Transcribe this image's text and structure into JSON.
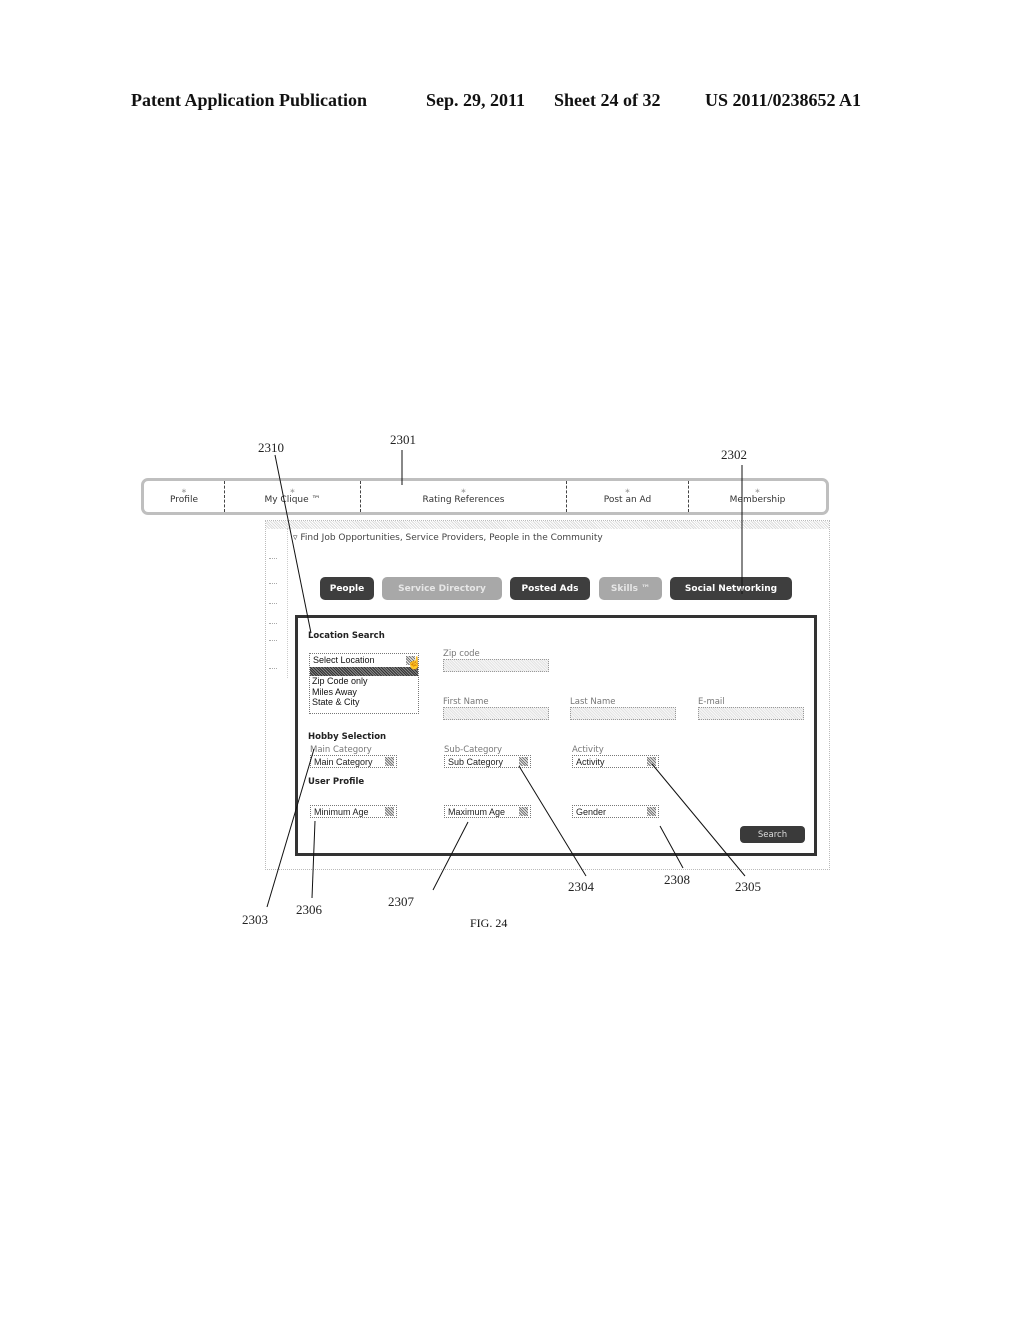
{
  "header": {
    "publication": "Patent Application Publication",
    "date": "Sep. 29, 2011",
    "sheet": "Sheet 24 of 32",
    "number": "US 2011/0238652 A1"
  },
  "reference_numerals": {
    "r2301": "2301",
    "r2302": "2302",
    "r2303": "2303",
    "r2304": "2304",
    "r2305": "2305",
    "r2306": "2306",
    "r2307": "2307",
    "r2308": "2308",
    "r2310": "2310"
  },
  "nav": {
    "items": [
      {
        "label": "Profile"
      },
      {
        "label": "My Clique ™"
      },
      {
        "label": "Rating References"
      },
      {
        "label": "Post an Ad"
      },
      {
        "label": "Membership"
      }
    ],
    "dot": "∗"
  },
  "panel": {
    "title": "▿ Find Job Opportunities, Service Providers, People in the Community",
    "tabs": [
      {
        "label": "People",
        "style": "dark"
      },
      {
        "label": "Service Directory",
        "style": "light"
      },
      {
        "label": "Posted Ads",
        "style": "dark"
      },
      {
        "label": "Skills ™",
        "style": "light"
      },
      {
        "label": "Social Networking",
        "style": "dark"
      }
    ]
  },
  "form": {
    "location_heading": "Location Search",
    "location_select": {
      "value": "Select Location",
      "options": [
        "Zip Code only",
        "Miles Away",
        "State & City"
      ]
    },
    "zip_label": "Zip code",
    "first_name_label": "First Name",
    "last_name_label": "Last Name",
    "email_label": "E-mail",
    "hobby_heading": "Hobby Selection",
    "main_category_label": "Main Category",
    "main_category_value": "Main Category",
    "sub_category_label": "Sub-Category",
    "sub_category_value": "Sub Category",
    "activity_label": "Activity",
    "activity_value": "Activity",
    "user_profile_heading": "User Profile",
    "min_age_value": "Minimum Age",
    "max_age_value": "Maximum Age",
    "gender_value": "Gender",
    "search_button": "Search"
  },
  "figure_caption": "FIG. 24"
}
